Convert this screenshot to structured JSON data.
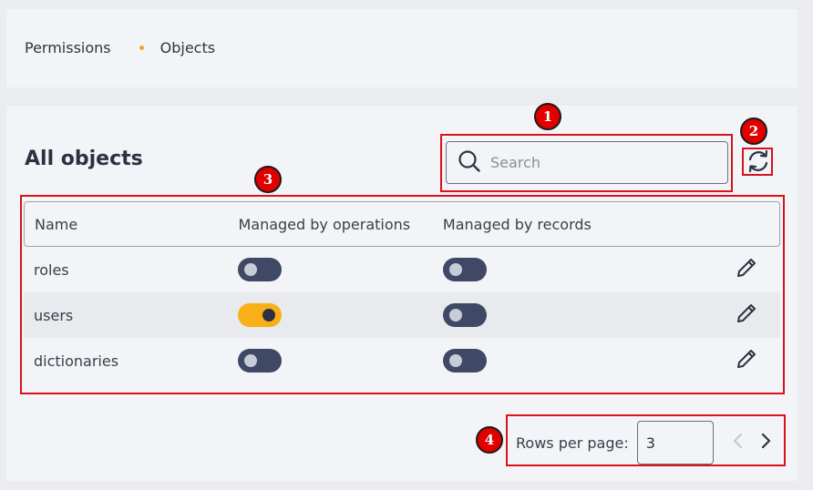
{
  "breadcrumb": {
    "items": [
      "Permissions",
      "Objects"
    ]
  },
  "page_title": "All objects",
  "search": {
    "placeholder": "Search",
    "value": ""
  },
  "table": {
    "headers": {
      "name": "Name",
      "managed_ops": "Managed by operations",
      "managed_records": "Managed by records"
    },
    "rows": [
      {
        "name": "roles",
        "managed_by_operations": false,
        "managed_by_records": false
      },
      {
        "name": "users",
        "managed_by_operations": true,
        "managed_by_records": false
      },
      {
        "name": "dictionaries",
        "managed_by_operations": false,
        "managed_by_records": false
      }
    ]
  },
  "pagination": {
    "label": "Rows per page:",
    "rows_per_page": "3"
  },
  "annotations": [
    "1",
    "2",
    "3",
    "4"
  ],
  "colors": {
    "accent": "#f7b016",
    "toggle_off": "#3f4864",
    "annotation": "#d9121c",
    "text": "#2f3340"
  },
  "icons": {
    "search": "search-icon",
    "refresh": "refresh-icon",
    "edit": "pencil-icon",
    "prev": "chevron-left-icon",
    "next": "chevron-right-icon"
  }
}
